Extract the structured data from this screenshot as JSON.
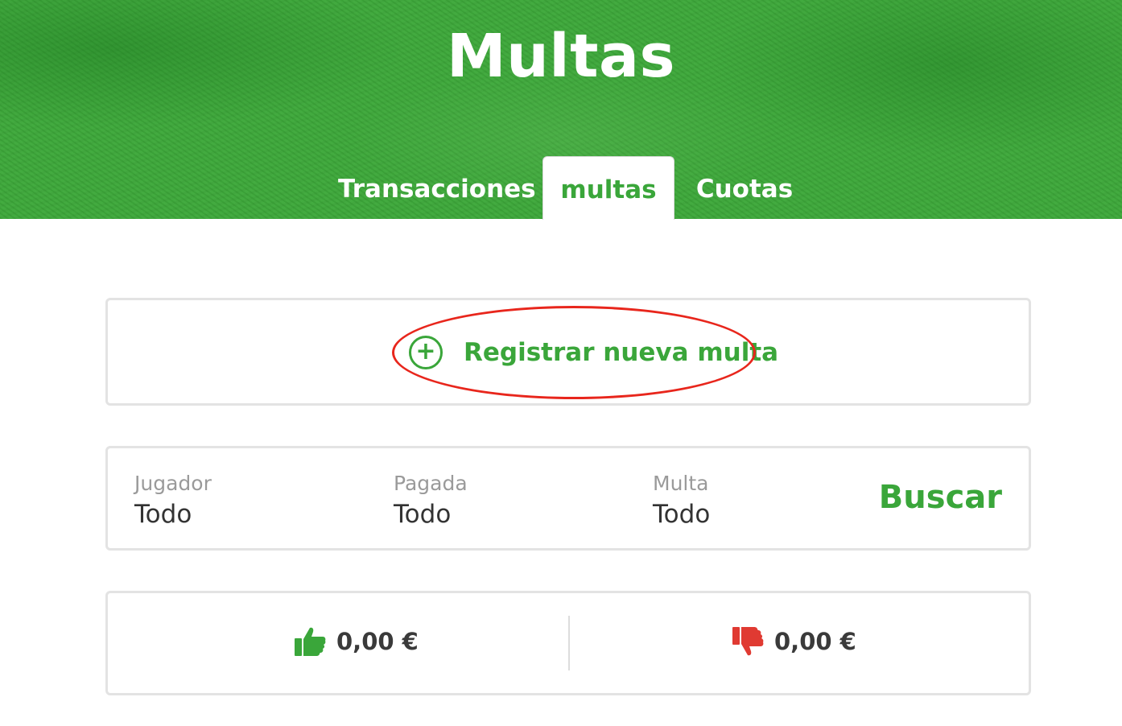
{
  "header": {
    "title": "Multas",
    "tabs": [
      {
        "label": "Transacciones",
        "active": false
      },
      {
        "label": "multas",
        "active": true
      },
      {
        "label": "Cuotas",
        "active": false
      }
    ]
  },
  "register": {
    "icon": "plus-circle-icon",
    "label": "Registrar nueva multa"
  },
  "filters": {
    "items": [
      {
        "label": "Jugador",
        "value": "Todo"
      },
      {
        "label": "Pagada",
        "value": "Todo"
      },
      {
        "label": "Multa",
        "value": "Todo"
      }
    ],
    "search_label": "Buscar"
  },
  "totals": {
    "positive": {
      "icon": "thumbs-up-icon",
      "value": "0,00 €"
    },
    "negative": {
      "icon": "thumbs-down-icon",
      "value": "0,00 €"
    }
  },
  "colors": {
    "brand_green": "#3aa63a",
    "header_green": "#3da83a",
    "negative_red": "#e03a32",
    "annotation_red": "#e8261c"
  }
}
